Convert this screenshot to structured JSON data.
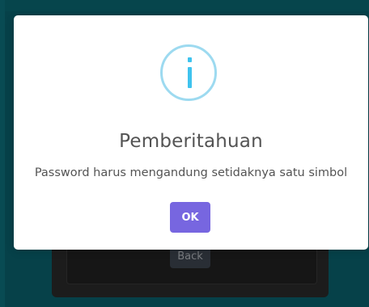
{
  "background": {
    "back_button_label": "Back"
  },
  "dialog": {
    "icon": "info-icon",
    "title": "Pemberitahuan",
    "message": "Password harus mengandung setidaknya satu simbol",
    "ok_label": "OK"
  },
  "colors": {
    "accent": "#7766e0",
    "info": "#3fc3ee",
    "background": "#0a6470"
  }
}
